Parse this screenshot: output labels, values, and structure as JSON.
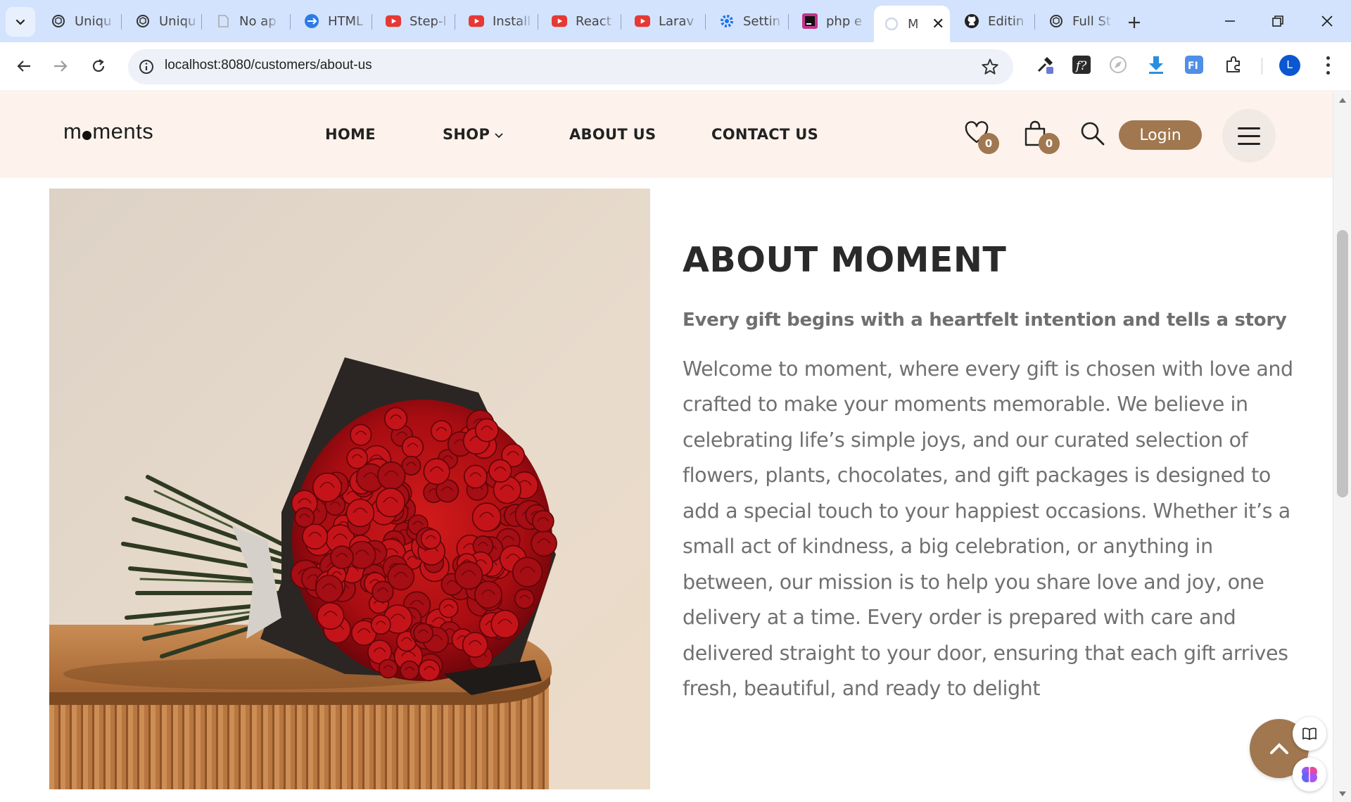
{
  "browser": {
    "tabs": [
      {
        "title": "Uniqu",
        "icon": "chatgpt-icon"
      },
      {
        "title": "Uniqu",
        "icon": "chatgpt-icon"
      },
      {
        "title": "No ap",
        "icon": "blank-page-icon"
      },
      {
        "title": "HTML",
        "icon": "html-site-icon"
      },
      {
        "title": "Step-l",
        "icon": "youtube-icon"
      },
      {
        "title": "Install",
        "icon": "youtube-icon"
      },
      {
        "title": "React",
        "icon": "youtube-icon"
      },
      {
        "title": "Larav",
        "icon": "youtube-icon"
      },
      {
        "title": "Settin",
        "icon": "gear-icon"
      },
      {
        "title": "php e",
        "icon": "phpstorm-icon"
      },
      {
        "title": "M",
        "icon": "loading-icon",
        "active": true
      },
      {
        "title": "Editin",
        "icon": "github-icon"
      },
      {
        "title": "Full St",
        "icon": "chatgpt-icon"
      }
    ],
    "url_host": "localhost",
    "url_rest": ":8080/customers/about-us",
    "profile_initial": "L",
    "colors": {
      "tabbar": "#d3e3fd",
      "omnibox": "#eef1f7",
      "profile": "#0b57d0"
    }
  },
  "site": {
    "logo_left": "m",
    "logo_right": "ments",
    "nav": [
      "HOME",
      "SHOP",
      "ABOUT US",
      "CONTACT US"
    ],
    "wishlist_count": "0",
    "cart_count": "0",
    "login_label": "Login",
    "colors": {
      "header_bg": "#fdf3ec",
      "accent": "#a0774f",
      "text": "#2a2a2a",
      "muted": "#707070"
    }
  },
  "about": {
    "title": "ABOUT MOMENT",
    "subtitle": "Every gift begins with a heartfelt intention and tells a story",
    "body": "Welcome to moment, where every gift is chosen with love and crafted to make your moments memorable. We believe in celebrating life’s simple joys, and our curated selection of flowers, plants, chocolates, and gift packages is designed to add a special touch to your happiest occasions. Whether it’s a small act of kindness, a big celebration, or anything in between, our mission is to help you share love and joy, one delivery at a time. Every order is prepared with care and delivered straight to your door, ensuring that each gift arrives fresh, beautiful, and ready to delight",
    "image": "red-rose-bouquet-on-wooden-table"
  }
}
